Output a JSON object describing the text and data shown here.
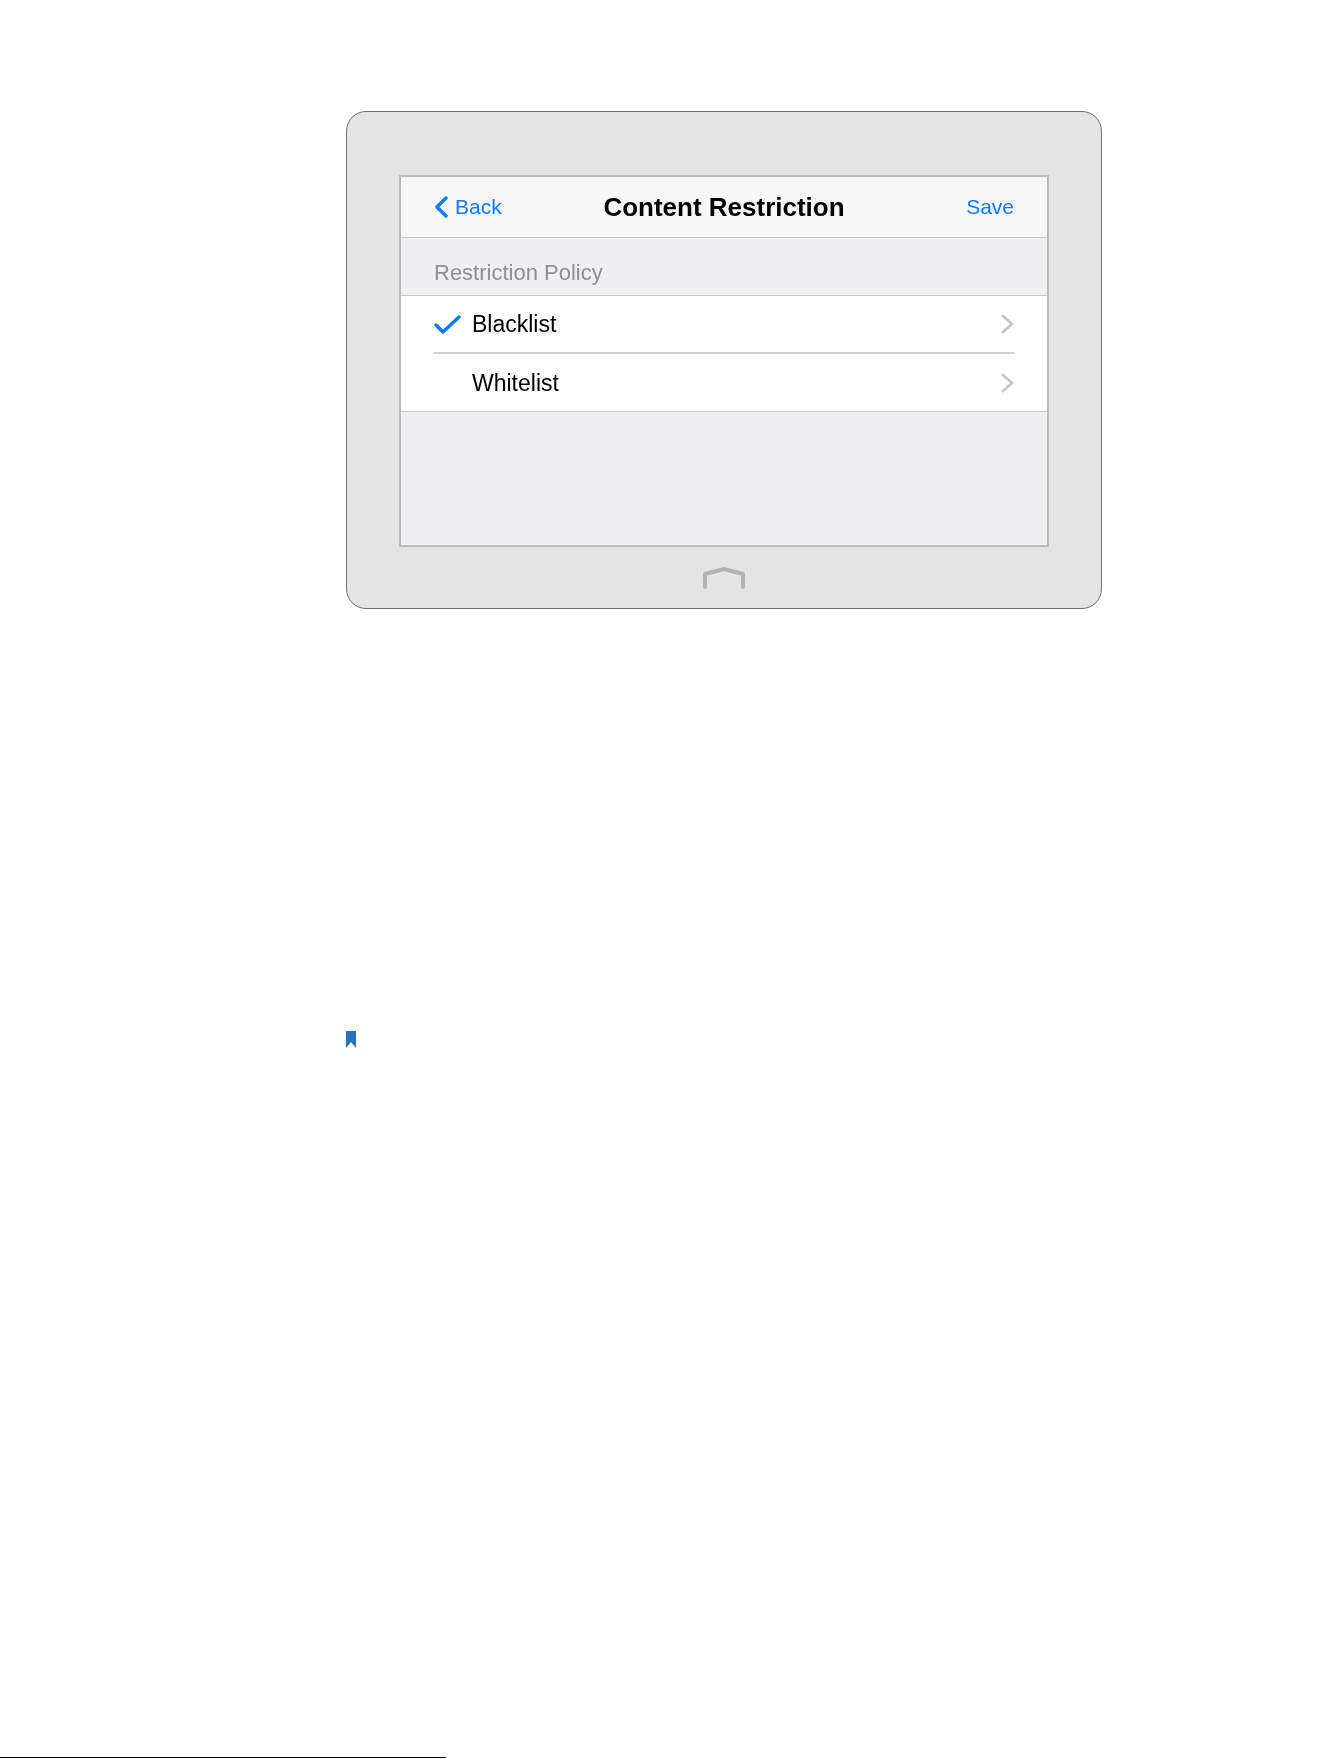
{
  "header": {
    "back": "Back",
    "title": "Content Restriction",
    "save": "Save"
  },
  "section": {
    "title": "Restriction Policy"
  },
  "options": [
    {
      "label": "Blacklist",
      "selected": true
    },
    {
      "label": "Whitelist",
      "selected": false
    }
  ]
}
